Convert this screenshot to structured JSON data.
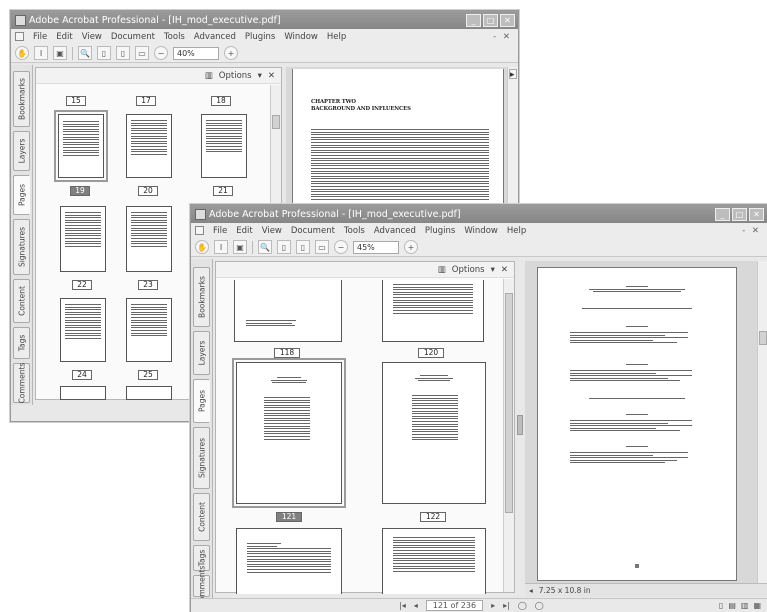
{
  "window_back": {
    "title": "Adobe Acrobat Professional - [IH_mod_executive.pdf]",
    "menus": [
      "File",
      "Edit",
      "View",
      "Document",
      "Tools",
      "Advanced",
      "Plugins",
      "Window",
      "Help"
    ],
    "menu_right": "- ✕",
    "zoom": "40%",
    "panel_title": "Options",
    "side_tabs": [
      "Bookmarks",
      "Layers",
      "Pages",
      "Signatures",
      "Content",
      "Tags",
      "Comments"
    ],
    "thumb_labels": [
      "15",
      "17",
      "18",
      "19",
      "20",
      "21",
      "22",
      "23",
      "24",
      "25"
    ],
    "doc_heading_1": "CHAPTER TWO",
    "doc_heading_2": "BACKGROUND AND INFLUENCES"
  },
  "window_front": {
    "title": "Adobe Acrobat Professional - [IH_mod_executive.pdf]",
    "menus": [
      "File",
      "Edit",
      "View",
      "Document",
      "Tools",
      "Advanced",
      "Plugins",
      "Window",
      "Help"
    ],
    "menu_right": "- ✕",
    "zoom": "45%",
    "panel_title": "Options",
    "side_tabs": [
      "Bookmarks",
      "Layers",
      "Pages",
      "Signatures",
      "Content",
      "Tags",
      "Comments"
    ],
    "thumb_labels": [
      "118",
      "120",
      "121",
      "122"
    ],
    "page_size": "7.25 x 10.8 in",
    "page_counter": "121 of 236"
  },
  "colors": {
    "titlebar": "#8f8f8f",
    "selected_label": "#808080"
  }
}
